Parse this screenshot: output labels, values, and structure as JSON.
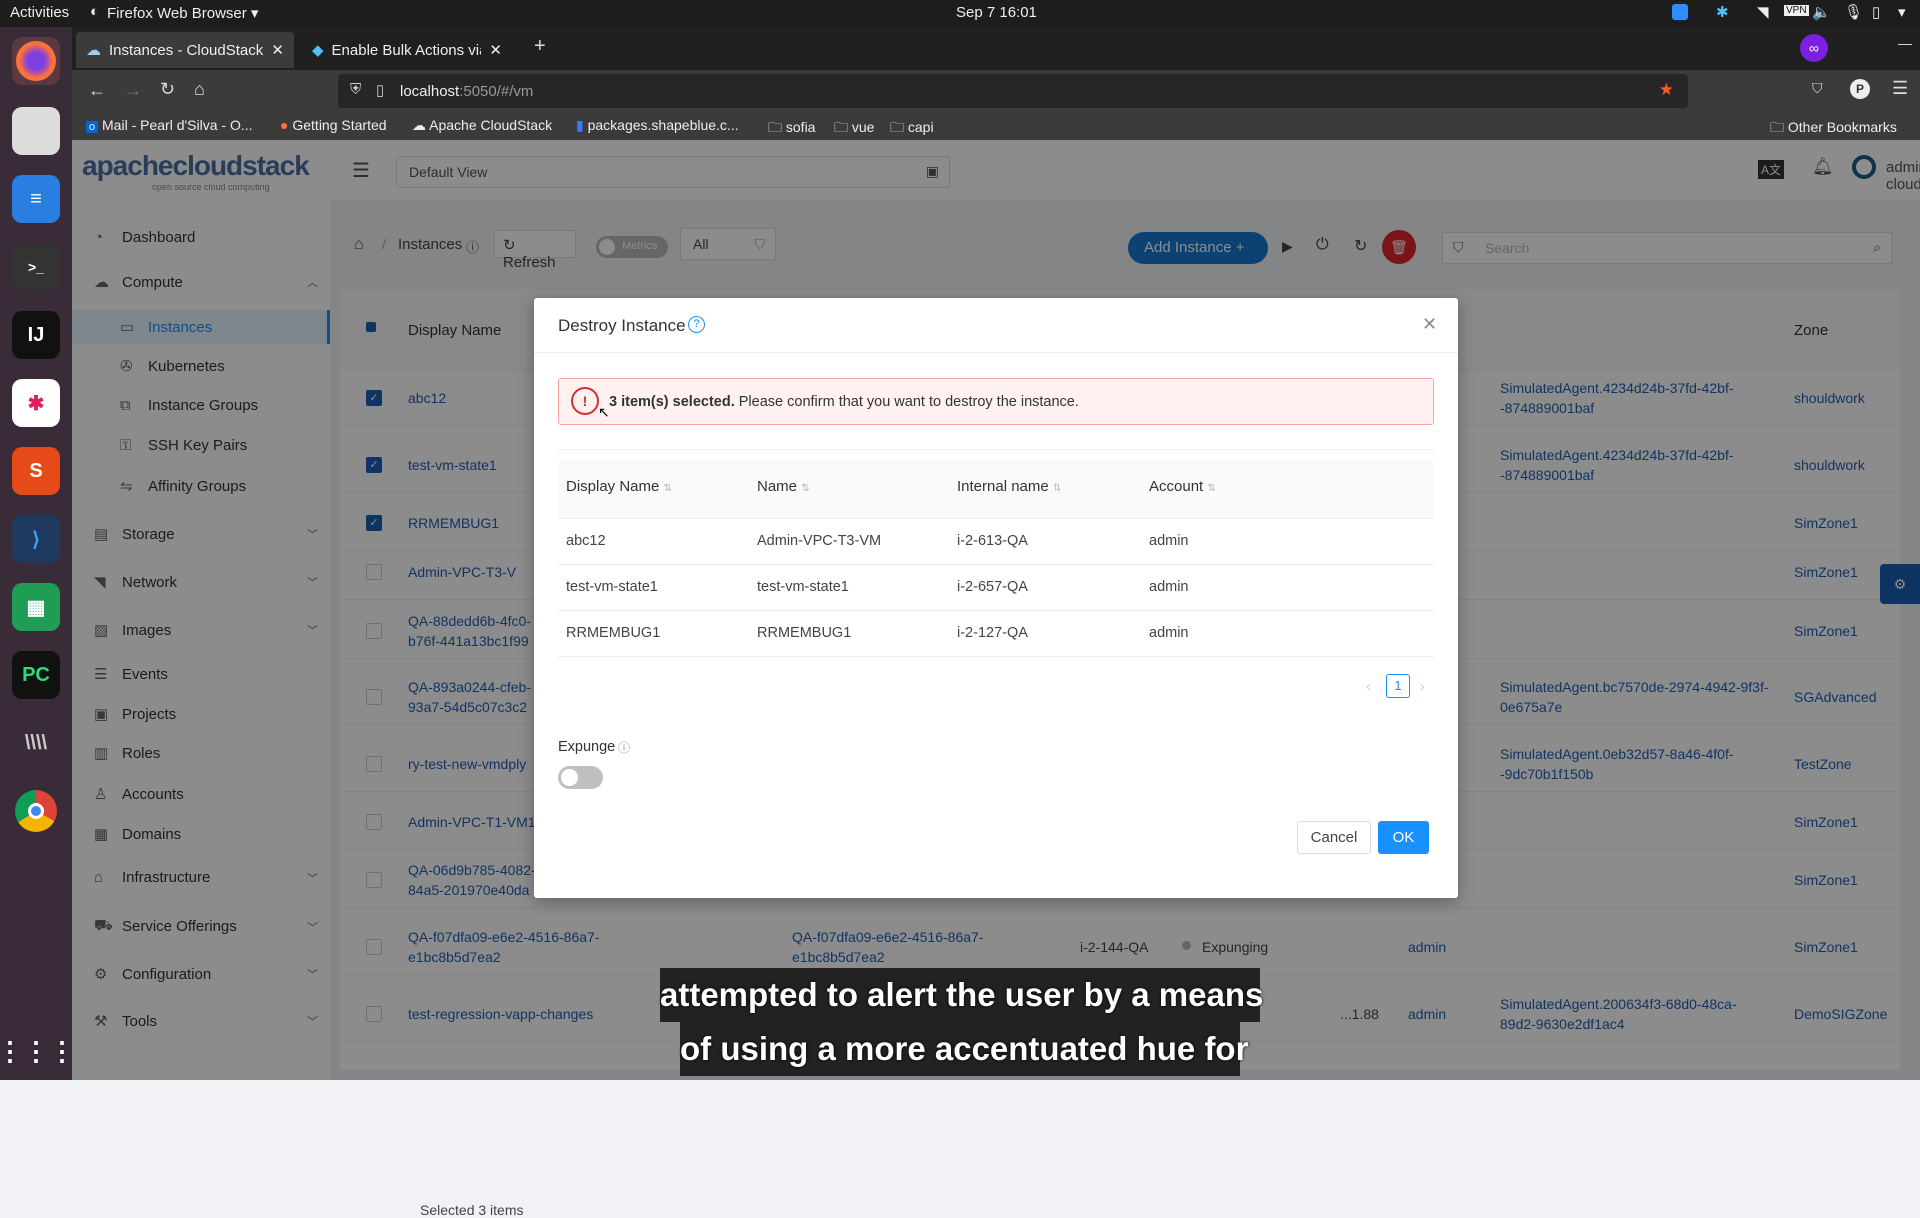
{
  "os": {
    "activities": "Activities",
    "app_menu": "Firefox Web Browser",
    "clock": "Sep 7  16:01"
  },
  "browser": {
    "tabs": [
      {
        "label": "Instances - CloudStack"
      },
      {
        "label": "Enable Bulk Actions via th"
      }
    ],
    "url_host": "localhost",
    "url_rest": ":5050/#/vm",
    "bookmarks": [
      "Mail - Pearl d'Silva - O...",
      "Getting Started",
      "Apache CloudStack",
      "packages.shapeblue.c...",
      "sofia",
      "vue",
      "capi"
    ],
    "other_bookmarks": "Other Bookmarks"
  },
  "app": {
    "logo": "apachecloudstack",
    "logo_tagline": "open source cloud computing",
    "view_select": "Default View",
    "user": "admin cloud",
    "sidebar": [
      {
        "label": "Dashboard",
        "icon": "dashboard-icon"
      },
      {
        "label": "Compute",
        "icon": "cloud-icon",
        "expand": "up"
      },
      {
        "label": "Instances",
        "icon": "desktop-icon",
        "sub": true,
        "active": true
      },
      {
        "label": "Kubernetes",
        "icon": "kubernetes-icon",
        "sub": true
      },
      {
        "label": "Instance Groups",
        "icon": "group-icon",
        "sub": true
      },
      {
        "label": "SSH Key Pairs",
        "icon": "key-icon",
        "sub": true
      },
      {
        "label": "Affinity Groups",
        "icon": "affinity-icon",
        "sub": true
      },
      {
        "label": "Storage",
        "icon": "storage-icon",
        "expand": "down"
      },
      {
        "label": "Network",
        "icon": "wifi-icon",
        "expand": "down"
      },
      {
        "label": "Images",
        "icon": "image-icon",
        "expand": "down"
      },
      {
        "label": "Events",
        "icon": "events-icon"
      },
      {
        "label": "Projects",
        "icon": "project-icon"
      },
      {
        "label": "Roles",
        "icon": "roles-icon"
      },
      {
        "label": "Accounts",
        "icon": "user-icon"
      },
      {
        "label": "Domains",
        "icon": "domain-icon"
      },
      {
        "label": "Infrastructure",
        "icon": "bank-icon",
        "expand": "down"
      },
      {
        "label": "Service Offerings",
        "icon": "offering-icon",
        "expand": "down"
      },
      {
        "label": "Configuration",
        "icon": "gear-icon",
        "expand": "down"
      },
      {
        "label": "Tools",
        "icon": "tool-icon",
        "expand": "down"
      }
    ],
    "breadcrumb": "Instances",
    "refresh": "Refresh",
    "metrics": "Metrics",
    "filter": "All",
    "add_instance": "Add Instance",
    "search_placeholder": "Search",
    "table": {
      "col_display_name": "Display Name",
      "col_zone": "Zone",
      "rows": [
        {
          "checked": true,
          "name": "abc12",
          "host": "SimulatedAgent.4234d24b-37fd-42bf-\n-874889001baf",
          "zone": "shouldwork"
        },
        {
          "checked": true,
          "name": "test-vm-state1",
          "host": "SimulatedAgent.4234d24b-37fd-42bf-\n-874889001baf",
          "zone": "shouldwork"
        },
        {
          "checked": true,
          "name": "RRMEMBUG1",
          "zone": "SimZone1"
        },
        {
          "checked": false,
          "name": "Admin-VPC-T3-V",
          "zone": "SimZone1"
        },
        {
          "checked": false,
          "name": "QA-88dedd6b-4fc0-\nb76f-441a13bc1f99",
          "zone": "SimZone1"
        },
        {
          "checked": false,
          "name": "QA-893a0244-cfeb-\n93a7-54d5c07c3c2",
          "host": "SimulatedAgent.bc7570de-2974-4942-9f3f-\n0e675a7e",
          "zone": "SGAdvanced"
        },
        {
          "checked": false,
          "name": "ry-test-new-vmdply",
          "host": "SimulatedAgent.0eb32d57-8a46-4f0f-\n-9dc70b1f150b",
          "zone": "TestZone"
        },
        {
          "checked": false,
          "name": "Admin-VPC-T1-VM1",
          "zone": "SimZone1"
        },
        {
          "checked": false,
          "name": "QA-06d9b785-4082-\n84a5-201970e40da",
          "zone": "SimZone1"
        },
        {
          "checked": false,
          "name": "QA-f07dfa09-e6e2-4516-86a7-\ne1bc8b5d7ea2",
          "name2": "QA-f07dfa09-e6e2-4516-86a7-\ne1bc8b5d7ea2",
          "internal": "i-2-144-QA",
          "state": "Expunging",
          "account": "admin",
          "zone": "SimZone1"
        },
        {
          "checked": false,
          "name": "test-regression-vapp-changes",
          "ip": "...1.88",
          "account": "admin",
          "host": "SimulatedAgent.200634f3-68d0-48ca-\n89d2-9630e2df1ac4",
          "zone": "DemoSIGZone"
        }
      ],
      "footer": "Selected 3 items"
    }
  },
  "modal": {
    "title": "Destroy Instance",
    "alert_bold": "3 item(s) selected.",
    "alert_text": " Please confirm that you want to destroy the instance.",
    "columns": [
      "Display Name",
      "Name",
      "Internal name",
      "Account"
    ],
    "rows": [
      [
        "abc12",
        "Admin-VPC-T3-VM",
        "i-2-613-QA",
        "admin"
      ],
      [
        "test-vm-state1",
        "test-vm-state1",
        "i-2-657-QA",
        "admin"
      ],
      [
        "RRMEMBUG1",
        "RRMEMBUG1",
        "i-2-127-QA",
        "admin"
      ]
    ],
    "page": "1",
    "expunge_label": "Expunge",
    "expunge_on": false,
    "cancel": "Cancel",
    "ok": "OK"
  },
  "subtitle": [
    "attempted to alert the user by a means",
    "of using a more accentuated hue for"
  ],
  "colors": {
    "primary": "#1890ff",
    "danger": "#d32f2f",
    "alert_bg": "#fff1f0",
    "alert_border": "#ffa39e"
  }
}
